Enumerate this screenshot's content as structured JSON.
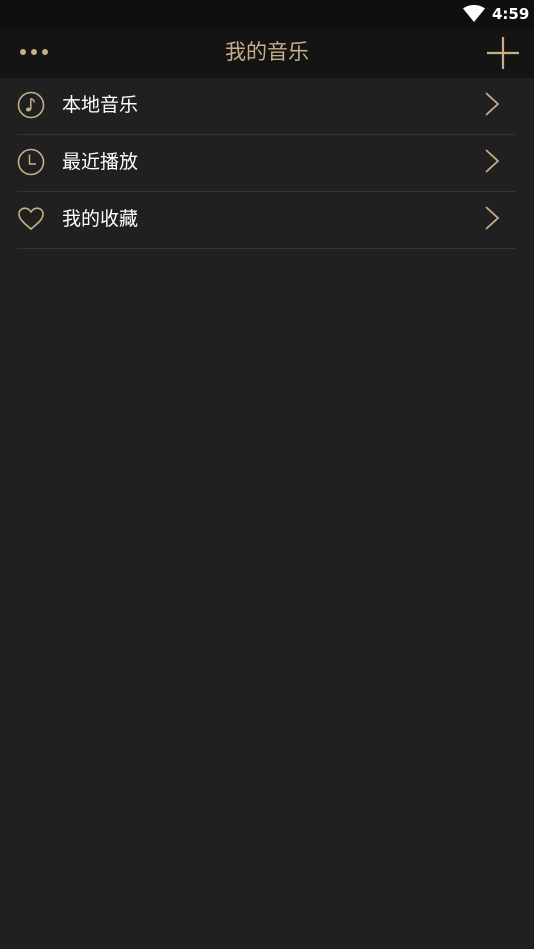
{
  "status_bar": {
    "time": "4:59",
    "wifi_icon": "wifi-icon"
  },
  "header": {
    "title": "我的音乐",
    "more_icon": "more-horizontal-icon",
    "add_icon": "plus-icon"
  },
  "colors": {
    "accent": "#c6ae87",
    "background": "#202020",
    "header_background": "#141414",
    "status_bar_background": "#0f0f0f",
    "divider": "#333333",
    "text": "#ffffff"
  },
  "menu": {
    "items": [
      {
        "label": "本地音乐",
        "icon": "music-note-icon"
      },
      {
        "label": "最近播放",
        "icon": "clock-icon"
      },
      {
        "label": "我的收藏",
        "icon": "heart-icon"
      }
    ]
  }
}
